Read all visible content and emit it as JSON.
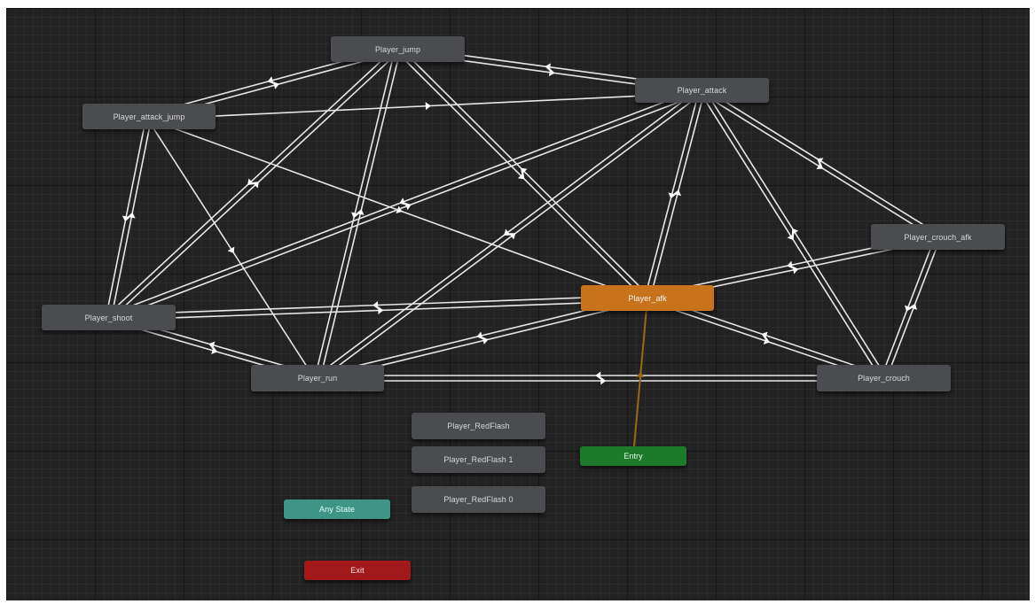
{
  "window": {
    "title": ""
  },
  "graph": {
    "states": [
      {
        "id": "jump",
        "label": "Player_jump",
        "kind": "state"
      },
      {
        "id": "attack",
        "label": "Player_attack",
        "kind": "state"
      },
      {
        "id": "attack_jump",
        "label": "Player_attack_jump",
        "kind": "state"
      },
      {
        "id": "crouch_afk",
        "label": "Player_crouch_afk",
        "kind": "state"
      },
      {
        "id": "afk",
        "label": "Player_afk",
        "kind": "default"
      },
      {
        "id": "shoot",
        "label": "Player_shoot",
        "kind": "state"
      },
      {
        "id": "run",
        "label": "Player_run",
        "kind": "state"
      },
      {
        "id": "crouch",
        "label": "Player_crouch",
        "kind": "state"
      },
      {
        "id": "redflash",
        "label": "Player_RedFlash",
        "kind": "state"
      },
      {
        "id": "redflash1",
        "label": "Player_RedFlash 1",
        "kind": "state"
      },
      {
        "id": "redflash0",
        "label": "Player_RedFlash 0",
        "kind": "state"
      },
      {
        "id": "entry",
        "label": "Entry",
        "kind": "entry"
      },
      {
        "id": "anystate",
        "label": "Any State",
        "kind": "anystate"
      },
      {
        "id": "exit",
        "label": "Exit",
        "kind": "exit"
      }
    ],
    "transitions": [
      {
        "from": "jump",
        "to": "attack"
      },
      {
        "from": "attack",
        "to": "jump"
      },
      {
        "from": "attack_jump",
        "to": "jump"
      },
      {
        "from": "jump",
        "to": "attack_jump"
      },
      {
        "from": "attack_jump",
        "to": "attack"
      },
      {
        "from": "attack_jump",
        "to": "shoot"
      },
      {
        "from": "shoot",
        "to": "attack_jump"
      },
      {
        "from": "attack_jump",
        "to": "run"
      },
      {
        "from": "attack_jump",
        "to": "afk"
      },
      {
        "from": "jump",
        "to": "shoot"
      },
      {
        "from": "shoot",
        "to": "jump"
      },
      {
        "from": "jump",
        "to": "run"
      },
      {
        "from": "run",
        "to": "jump"
      },
      {
        "from": "jump",
        "to": "afk"
      },
      {
        "from": "afk",
        "to": "jump"
      },
      {
        "from": "attack",
        "to": "shoot"
      },
      {
        "from": "shoot",
        "to": "attack"
      },
      {
        "from": "attack",
        "to": "run"
      },
      {
        "from": "run",
        "to": "attack"
      },
      {
        "from": "attack",
        "to": "afk"
      },
      {
        "from": "afk",
        "to": "attack"
      },
      {
        "from": "attack",
        "to": "crouch"
      },
      {
        "from": "crouch",
        "to": "attack"
      },
      {
        "from": "attack",
        "to": "crouch_afk"
      },
      {
        "from": "crouch_afk",
        "to": "attack"
      },
      {
        "from": "crouch_afk",
        "to": "afk"
      },
      {
        "from": "afk",
        "to": "crouch_afk"
      },
      {
        "from": "crouch_afk",
        "to": "crouch"
      },
      {
        "from": "crouch",
        "to": "crouch_afk"
      },
      {
        "from": "shoot",
        "to": "afk"
      },
      {
        "from": "afk",
        "to": "shoot"
      },
      {
        "from": "shoot",
        "to": "run"
      },
      {
        "from": "run",
        "to": "shoot"
      },
      {
        "from": "run",
        "to": "afk"
      },
      {
        "from": "afk",
        "to": "run"
      },
      {
        "from": "run",
        "to": "crouch"
      },
      {
        "from": "crouch",
        "to": "run"
      },
      {
        "from": "afk",
        "to": "crouch"
      },
      {
        "from": "crouch",
        "to": "afk"
      },
      {
        "from": "entry",
        "to": "afk",
        "kind": "entry"
      }
    ]
  },
  "colors": {
    "grid_bg": "#222222",
    "state": "#4a4c50",
    "default_state": "#c8731c",
    "entry": "#1d7a2b",
    "any_state": "#3e9584",
    "exit": "#a31818",
    "transition": "#e6e6e6",
    "entry_transition": "#9a6a1a"
  }
}
